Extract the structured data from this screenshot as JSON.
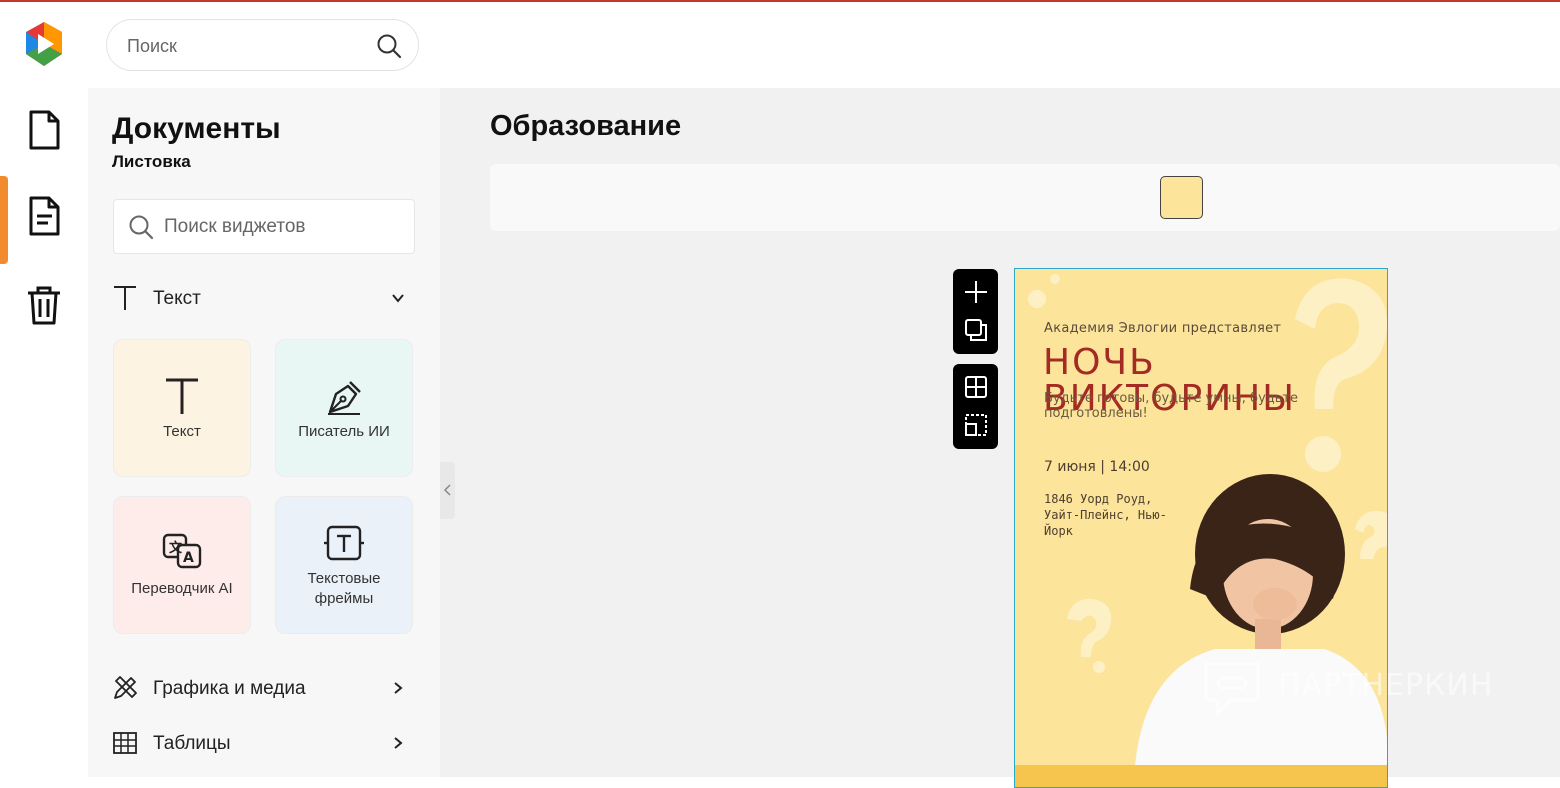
{
  "header": {
    "search_placeholder": "Поиск"
  },
  "rail": {
    "items": [
      "document-icon",
      "document-text-icon",
      "trash-icon"
    ],
    "active_index": 1
  },
  "panel": {
    "title": "Документы",
    "subtitle": "Листовка",
    "widget_search_placeholder": "Поиск виджетов",
    "text_section": {
      "label": "Текст",
      "expanded": true
    },
    "cards": [
      {
        "label": "Текст",
        "icon": "text-t-icon",
        "bg": "#fdf3e3"
      },
      {
        "label": "Писатель ИИ",
        "icon": "pen-nib-icon",
        "bg": "#e8f6f4"
      },
      {
        "label": "Переводчик AI",
        "icon": "translate-icon",
        "bg": "#fdecea"
      },
      {
        "label": "Текстовые фреймы",
        "icon": "text-frame-icon",
        "bg": "#eaf1f8"
      }
    ],
    "graphics_section": {
      "label": "Графика и медиа"
    },
    "tables_section": {
      "label": "Таблицы"
    }
  },
  "main": {
    "title": "Образование",
    "swatch_color": "#fce49b"
  },
  "document": {
    "bg_color": "#fce49b",
    "intro": "Академия Эвлогии представляет",
    "headline": "НОЧЬ ВИКТОРИНЫ",
    "tagline": "Будьте готовы, будьте умны, будьте подготовлены!",
    "date": "7 июня | 14:00",
    "address": "1846 Уорд Роуд, Уайт-Плейнс, Нью-Йорк"
  },
  "watermark": {
    "text": "ПАРТНЕРКИН"
  }
}
